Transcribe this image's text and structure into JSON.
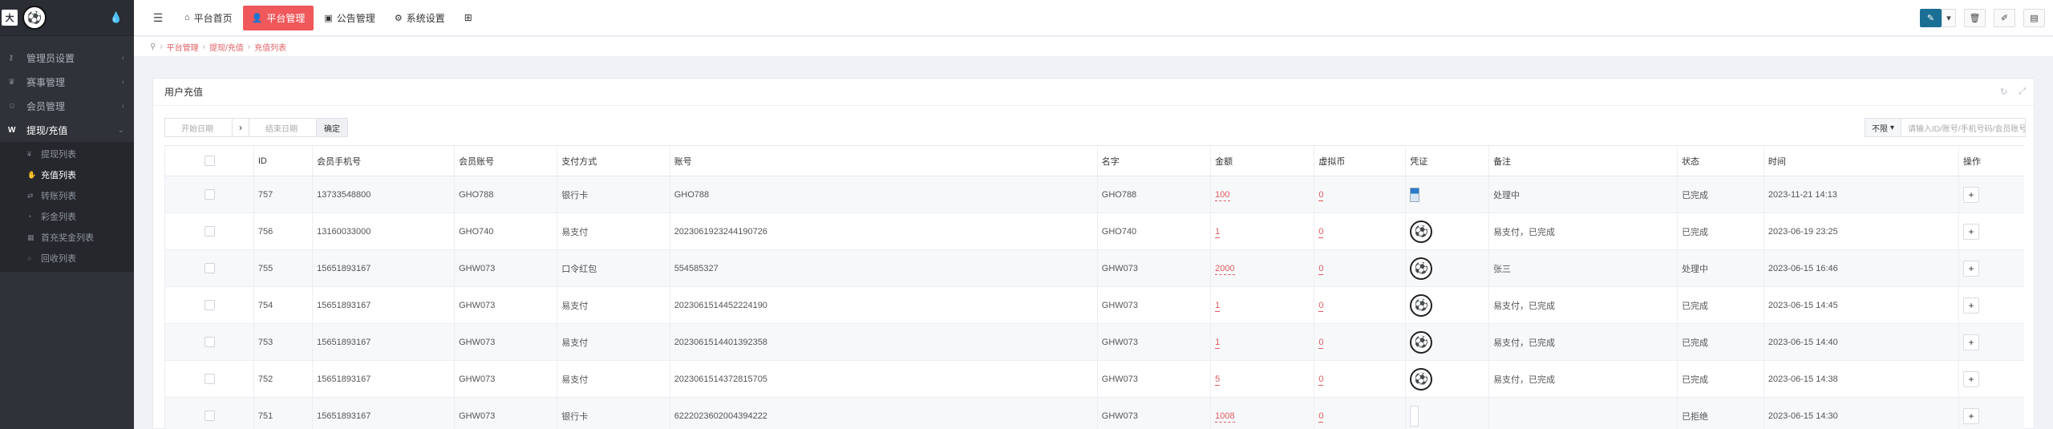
{
  "sidebar": {
    "brand_logo": "大",
    "nav": [
      {
        "label": "管理员设置",
        "icon": "key-icon"
      },
      {
        "label": "赛事管理",
        "icon": "trophy-icon"
      },
      {
        "label": "会员管理",
        "icon": "user-icon"
      }
    ],
    "active_group": {
      "label": "提现/充值",
      "icon": "w-icon"
    },
    "sub_items": [
      {
        "label": "提现列表"
      },
      {
        "label": "充值列表"
      },
      {
        "label": "转账列表"
      },
      {
        "label": "彩金列表"
      },
      {
        "label": "首充奖金列表"
      },
      {
        "label": "回收列表"
      }
    ]
  },
  "topbar": {
    "tabs": [
      {
        "label": "平台首页",
        "icon": "home-icon"
      },
      {
        "label": "平台管理",
        "icon": "user-icon"
      },
      {
        "label": "公告管理",
        "icon": "notice-icon"
      },
      {
        "label": "系统设置",
        "icon": "gear-icon"
      }
    ]
  },
  "breadcrumb": [
    "平台管理",
    "提现/充值",
    "充值列表"
  ],
  "panel": {
    "title": "用户充值"
  },
  "filter": {
    "start_placeholder": "开始日期",
    "end_placeholder": "结束日期",
    "confirm_label": "确定",
    "limit_label": "不限",
    "search_placeholder": "请输入ID/账号/手机号码/会员账号"
  },
  "table": {
    "headers": [
      "ID",
      "会员手机号",
      "会员账号",
      "支付方式",
      "账号",
      "名字",
      "金额",
      "虚拟币",
      "凭证",
      "备注",
      "状态",
      "时间",
      "操作"
    ],
    "rows": [
      {
        "id": "757",
        "phone": "13733548800",
        "account": "GHO788",
        "pay": "银行卡",
        "acc_no": "GHO788",
        "name": "GHO788",
        "amount": "100",
        "coin": "0",
        "cert": "image",
        "remark": "处理中",
        "status": "已完成",
        "time": "2023-11-21 14:13"
      },
      {
        "id": "756",
        "phone": "13160033000",
        "account": "GHO740",
        "pay": "易支付",
        "acc_no": "2023061923244190726",
        "name": "GHO740",
        "amount": "1",
        "coin": "0",
        "cert": "ball",
        "remark": "易支付，已完成",
        "status": "已完成",
        "time": "2023-06-19 23:25"
      },
      {
        "id": "755",
        "phone": "15651893167",
        "account": "GHW073",
        "pay": "口令红包",
        "acc_no": "554585327",
        "name": "GHW073",
        "amount": "2000",
        "coin": "0",
        "cert": "ball",
        "remark": "张三",
        "status": "处理中",
        "time": "2023-06-15 16:46"
      },
      {
        "id": "754",
        "phone": "15651893167",
        "account": "GHW073",
        "pay": "易支付",
        "acc_no": "2023061514452224190",
        "name": "GHW073",
        "amount": "1",
        "coin": "0",
        "cert": "ball",
        "remark": "易支付，已完成",
        "status": "已完成",
        "time": "2023-06-15 14:45"
      },
      {
        "id": "753",
        "phone": "15651893167",
        "account": "GHW073",
        "pay": "易支付",
        "acc_no": "2023061514401392358",
        "name": "GHW073",
        "amount": "1",
        "coin": "0",
        "cert": "ball",
        "remark": "易支付，已完成",
        "status": "已完成",
        "time": "2023-06-15 14:40"
      },
      {
        "id": "752",
        "phone": "15651893167",
        "account": "GHW073",
        "pay": "易支付",
        "acc_no": "2023061514372815705",
        "name": "GHW073",
        "amount": "5",
        "coin": "0",
        "cert": "ball",
        "remark": "易支付，已完成",
        "status": "已完成",
        "time": "2023-06-15 14:38"
      },
      {
        "id": "751",
        "phone": "15651893167",
        "account": "GHW073",
        "pay": "银行卡",
        "acc_no": "6222023602004394222",
        "name": "GHW073",
        "amount": "1008",
        "coin": "0",
        "cert": "blank",
        "remark": "",
        "status": "已拒绝",
        "time": "2023-06-15 14:30"
      }
    ]
  }
}
